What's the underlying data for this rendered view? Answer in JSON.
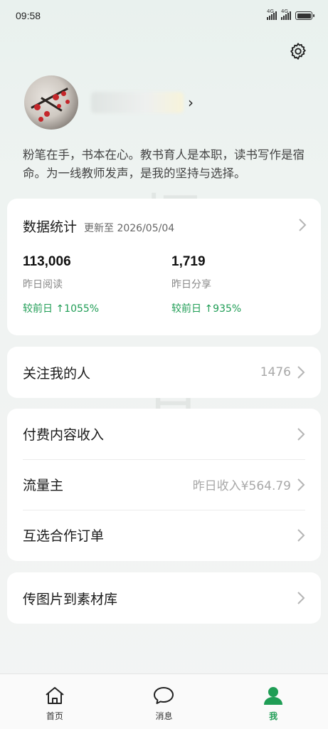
{
  "status_bar": {
    "time": "09:58",
    "network_1": "4G",
    "network_2": "4G"
  },
  "profile": {
    "bio": "粉笔在手，书本在心。教书育人是本职，读书写作是宿命。为一线教师发声，是我的坚持与选择。"
  },
  "watermark": "梧桐有木",
  "stats": {
    "title": "数据统计",
    "updated": "更新至 2026/05/04",
    "reads": {
      "value": "113,006",
      "label": "昨日阅读",
      "delta": "较前日 ↑1055%"
    },
    "shares": {
      "value": "1,719",
      "label": "昨日分享",
      "delta": "较前日 ↑935%"
    }
  },
  "followers": {
    "label": "关注我的人",
    "count": "1476"
  },
  "menu": {
    "paid_content": {
      "label": "付费内容收入"
    },
    "traffic_owner": {
      "label": "流量主",
      "value": "昨日收入¥564.79"
    },
    "mutual_orders": {
      "label": "互选合作订单"
    }
  },
  "upload": {
    "label": "传图片到素材库"
  },
  "tabbar": {
    "home": "首页",
    "messages": "消息",
    "me": "我"
  },
  "colors": {
    "accent_green": "#1f9d55",
    "card_bg": "#ffffff",
    "page_bg": "#eef3f1"
  }
}
